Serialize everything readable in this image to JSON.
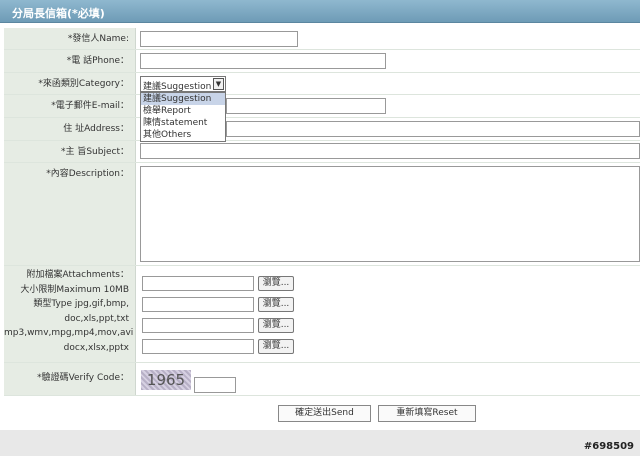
{
  "header": {
    "title": "分局長信箱(*必填)"
  },
  "form": {
    "name_label": "*發信人Name:",
    "phone_label": "*電 話Phone：",
    "category_label": "*來函類別Category：",
    "category_selected": "建議Suggestion",
    "category_options": [
      "建議Suggestion",
      "檢舉Report",
      "陳情statement",
      "其他Others"
    ],
    "email_label": "*電子郵件E-mail：",
    "address_label": "住 址Address：",
    "subject_label": "*主 旨Subject：",
    "description_label": "*內容Description：",
    "attach_lines": [
      "附加檔案Attachments：",
      "大小限制Maximum 10MB",
      "類型Type jpg,gif,bmp,",
      "doc,xls,ppt,txt",
      "mp3,wmv,mpg,mp4,mov,avi",
      "docx,xlsx,pptx"
    ],
    "browse_label": "瀏覽...",
    "verify_label": "*驗證碼Verify Code：",
    "captcha_text": "1965"
  },
  "buttons": {
    "send": "確定送出Send",
    "reset": "重新填寫Reset"
  },
  "watermark": "#698509"
}
